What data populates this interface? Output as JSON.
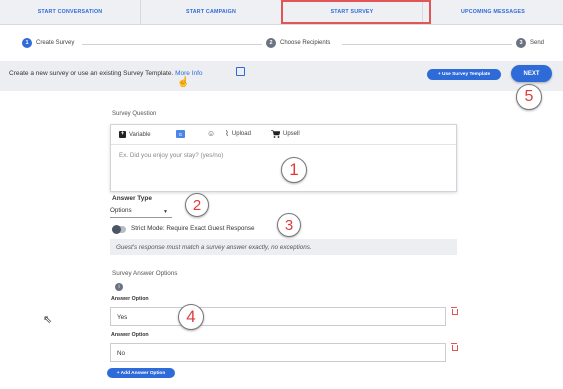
{
  "tabs": [
    {
      "label": "START CONVERSATION"
    },
    {
      "label": "START CAMPAIGN"
    },
    {
      "label": "START SURVEY"
    },
    {
      "label": "UPCOMING MESSAGES"
    }
  ],
  "stepper": {
    "steps": [
      {
        "num": "1",
        "label": "Create Survey"
      },
      {
        "num": "2",
        "label": "Choose Recipients"
      },
      {
        "num": "3",
        "label": "Send"
      }
    ]
  },
  "infobar": {
    "text": "Create a new survey or use an existing Survey Template.",
    "link": "More Info",
    "template_button": "+ Use Survey Template",
    "next_button": "NEXT"
  },
  "question": {
    "label": "Survey Question",
    "toolbar": {
      "variable": "Variable",
      "upload": "Upload",
      "upsell": "Upsell"
    },
    "placeholder": "Ex. Did you enjoy your stay? (yes/no)"
  },
  "answer_type": {
    "label": "Answer Type",
    "value": "Options"
  },
  "strict_mode": {
    "label": "Strict Mode: Require Exact Guest Response",
    "hint": "Guest's response must match a survey answer exactly, no exceptions."
  },
  "answer_options": {
    "label": "Survey Answer Options",
    "info_icon": "i",
    "options": [
      {
        "label": "Answer Option",
        "value": "Yes"
      },
      {
        "label": "Answer Option",
        "value": "No"
      }
    ],
    "add_button": "+ Add Answer Option"
  },
  "annotations": [
    "1",
    "2",
    "3",
    "4",
    "5"
  ],
  "colors": {
    "accent": "#2f6bd8",
    "annotation": "#e03c3c",
    "highlight": "#e05555"
  }
}
